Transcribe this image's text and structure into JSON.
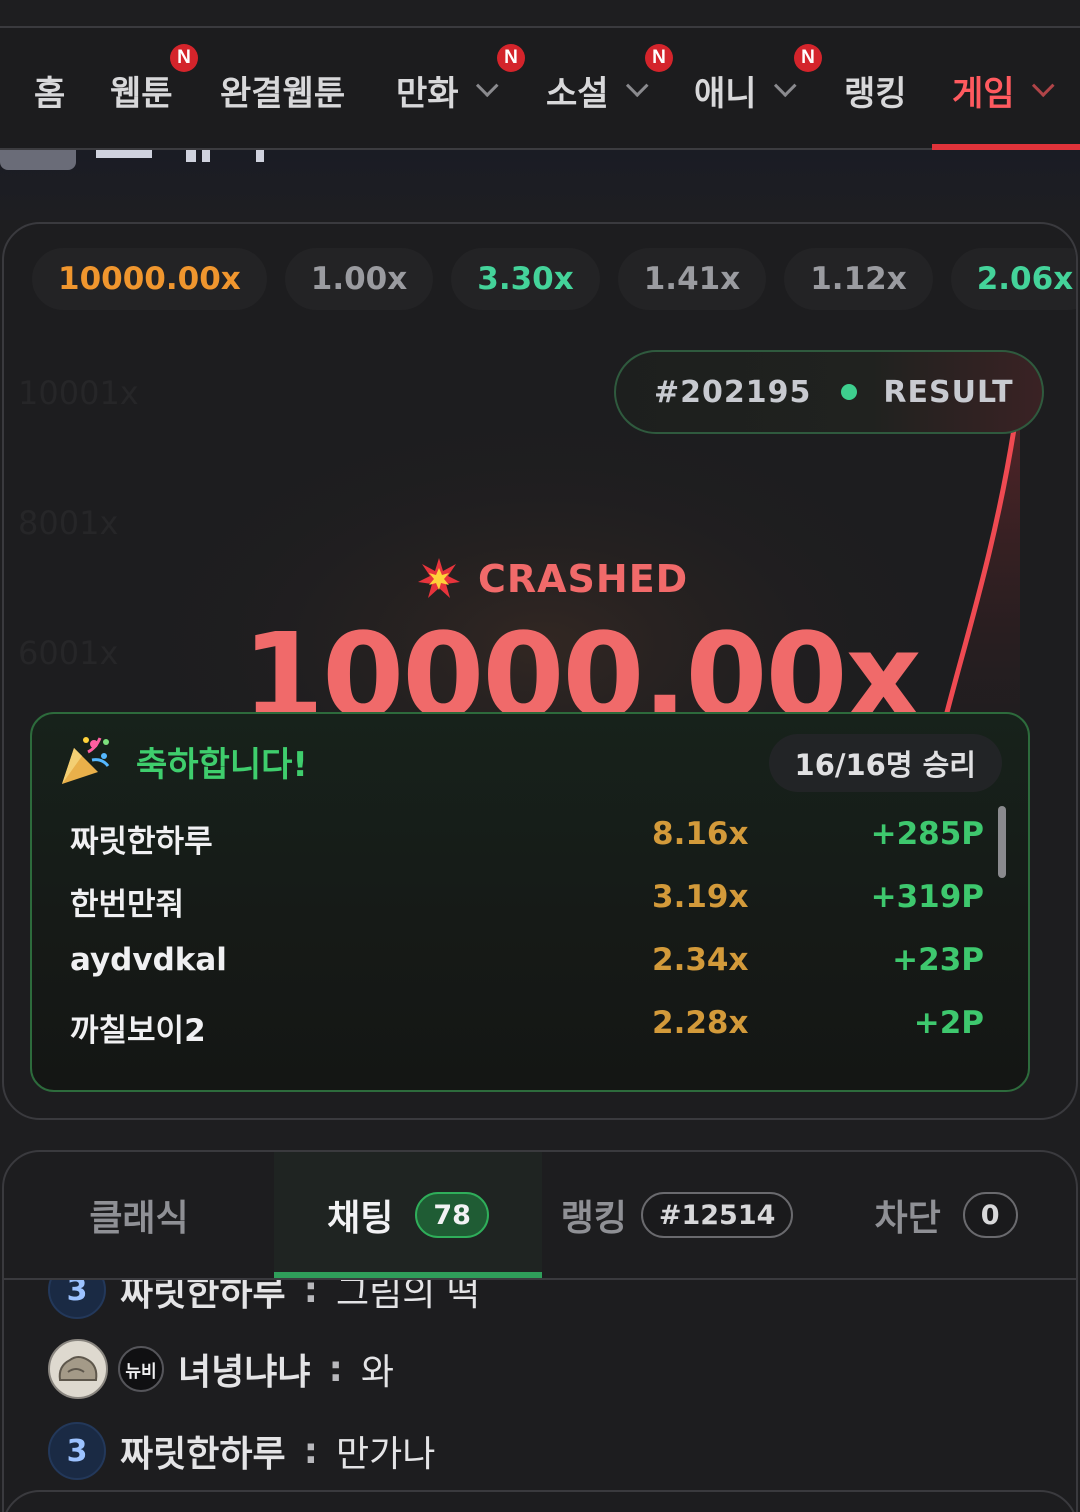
{
  "nav": {
    "items": [
      {
        "label": "홈",
        "new": false,
        "dropdown": false,
        "active": false
      },
      {
        "label": "웹툰",
        "new": true,
        "dropdown": false,
        "active": false
      },
      {
        "label": "완결웹툰",
        "new": false,
        "dropdown": false,
        "active": false
      },
      {
        "label": "만화",
        "new": true,
        "dropdown": true,
        "active": false
      },
      {
        "label": "소설",
        "new": true,
        "dropdown": true,
        "active": false
      },
      {
        "label": "애니",
        "new": true,
        "dropdown": true,
        "active": false
      },
      {
        "label": "랭킹",
        "new": false,
        "dropdown": false,
        "active": false
      },
      {
        "label": "게임",
        "new": false,
        "dropdown": true,
        "active": true
      }
    ],
    "new_badge": "N"
  },
  "game": {
    "history": [
      {
        "value": "10000.00x",
        "color": "#f0962e"
      },
      {
        "value": "1.00x",
        "color": "#9a9ba0"
      },
      {
        "value": "3.30x",
        "color": "#44d39a"
      },
      {
        "value": "1.41x",
        "color": "#9a9ba0"
      },
      {
        "value": "1.12x",
        "color": "#9a9ba0"
      },
      {
        "value": "2.06x",
        "color": "#44d39a"
      }
    ],
    "round_id": "#202195",
    "round_status": "RESULT",
    "y_ticks": [
      "10001x",
      "8001x",
      "6001x"
    ],
    "crashed_label": "CRASHED",
    "crash_multiplier": "10000.00x",
    "winners": {
      "title": "축하합니다!",
      "count": "16/16명 승리",
      "rows": [
        {
          "name": "짜릿한하루",
          "multiplier": "8.16x",
          "points": "+285P"
        },
        {
          "name": "한번만줘",
          "multiplier": "3.19x",
          "points": "+319P"
        },
        {
          "name": "aydvdkal",
          "multiplier": "2.34x",
          "points": "+23P"
        },
        {
          "name": "까칠보이2",
          "multiplier": "2.28x",
          "points": "+2P"
        }
      ]
    }
  },
  "tabs": [
    {
      "label": "클래식",
      "badge": "",
      "active": false
    },
    {
      "label": "채팅",
      "badge": "78",
      "active": true
    },
    {
      "label": "랭킹",
      "badge": "#12514",
      "active": false
    },
    {
      "label": "차단",
      "badge": "0",
      "active": false
    }
  ],
  "chat": [
    {
      "level": "3",
      "name": "짜릿한하루",
      "sep": ":",
      "message": "그림의 떡",
      "avatar": false
    },
    {
      "level": "",
      "rookie": "뉴비",
      "name": "녀녕냐냐",
      "sep": ":",
      "message": "와",
      "avatar": true
    },
    {
      "level": "3",
      "name": "짜릿한하루",
      "sep": ":",
      "message": "만가나",
      "avatar": false
    }
  ],
  "colors": {
    "accent_red": "#e0333a",
    "accent_green": "#2f9e5a",
    "multiplier_gold": "#d39a3a",
    "points_green": "#3ec86e"
  }
}
